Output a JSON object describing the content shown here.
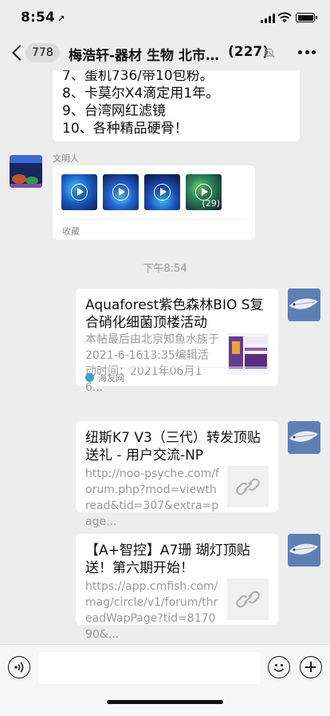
{
  "status_bar": {
    "time": "8:54",
    "location_glyph": "↗"
  },
  "header": {
    "back_badge": "778",
    "title": "梅浩轩-器材 生物 北市…",
    "member_count": "(227)",
    "icons": {
      "back": "chevron-left-icon",
      "mute": "mute-bell-icon",
      "more": "more-dots-icon"
    }
  },
  "messages": {
    "list_tail": [
      "7、蛋机736/带10包粉。",
      "8、卡莫尔X4滴定用1年。",
      "9、台湾网红滤镜",
      "10、各种精品硬骨！"
    ],
    "forward": {
      "sender": "文明人",
      "thumb_count": "(29)",
      "footer": "收藏"
    },
    "timestamp": "下午8:54",
    "cards": [
      {
        "title": "Aquaforest紫色森林BIO S复合硝化细菌顶楼活动",
        "desc": "本帖最后由北京知鱼水族于2021-6-1613:35编辑活动时间：2021年06月16...",
        "source": "海友网"
      },
      {
        "title": "纽斯K7 V3（三代）转发顶贴送礼 - 用户交流-NP",
        "desc": "http://noo-psyche.com/forum.php?mod=viewthread&tid=307&extra=page...",
        "icon": "link-icon"
      },
      {
        "title": "【A+智控】A7珊 瑚灯顶贴送！第六期开始！",
        "desc": "https://app.cmfish.com/mag/circle/v1/forum/threadWapPage?tid=817090&...",
        "icon": "link-icon"
      }
    ]
  },
  "input_bar": {
    "placeholder": "",
    "icons": {
      "voice": "voice-icon",
      "emoji": "emoji-icon",
      "plus": "plus-icon"
    }
  }
}
